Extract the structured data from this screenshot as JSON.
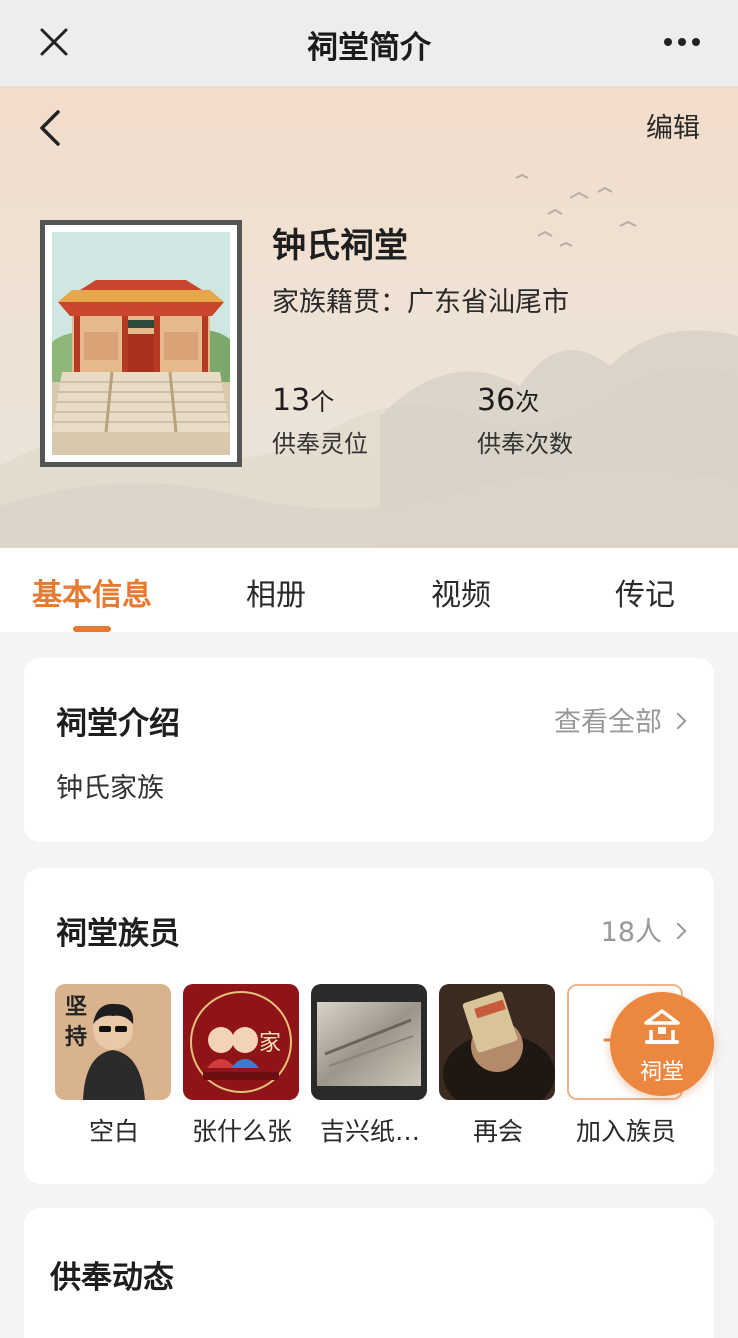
{
  "topbar": {
    "title": "祠堂简介",
    "close_icon": "close-icon",
    "more_icon": "more-dots-icon"
  },
  "header": {
    "edit_label": "编辑",
    "hall_name": "钟氏祠堂",
    "origin": "家族籍贯：广东省汕尾市",
    "stats": [
      {
        "value": "13",
        "unit": "个",
        "label": "供奉灵位"
      },
      {
        "value": "36",
        "unit": "次",
        "label": "供奉次数"
      }
    ]
  },
  "tabs": [
    {
      "label": "基本信息",
      "active": true
    },
    {
      "label": "相册",
      "active": false
    },
    {
      "label": "视频",
      "active": false
    },
    {
      "label": "传记",
      "active": false
    }
  ],
  "intro": {
    "title": "祠堂介绍",
    "more_label": "查看全部",
    "text": "钟氏家族"
  },
  "members": {
    "title": "祠堂族员",
    "count_label": "18人",
    "list": [
      {
        "name": "空白"
      },
      {
        "name": "张什么张"
      },
      {
        "name": "吉兴纸…"
      },
      {
        "name": "再会"
      }
    ],
    "add_label": "加入族员"
  },
  "feed": {
    "title": "供奉动态"
  },
  "fab": {
    "label": "祠堂"
  },
  "colors": {
    "accent": "#e57a30",
    "fab": "#ec8740",
    "muted": "#999999"
  }
}
